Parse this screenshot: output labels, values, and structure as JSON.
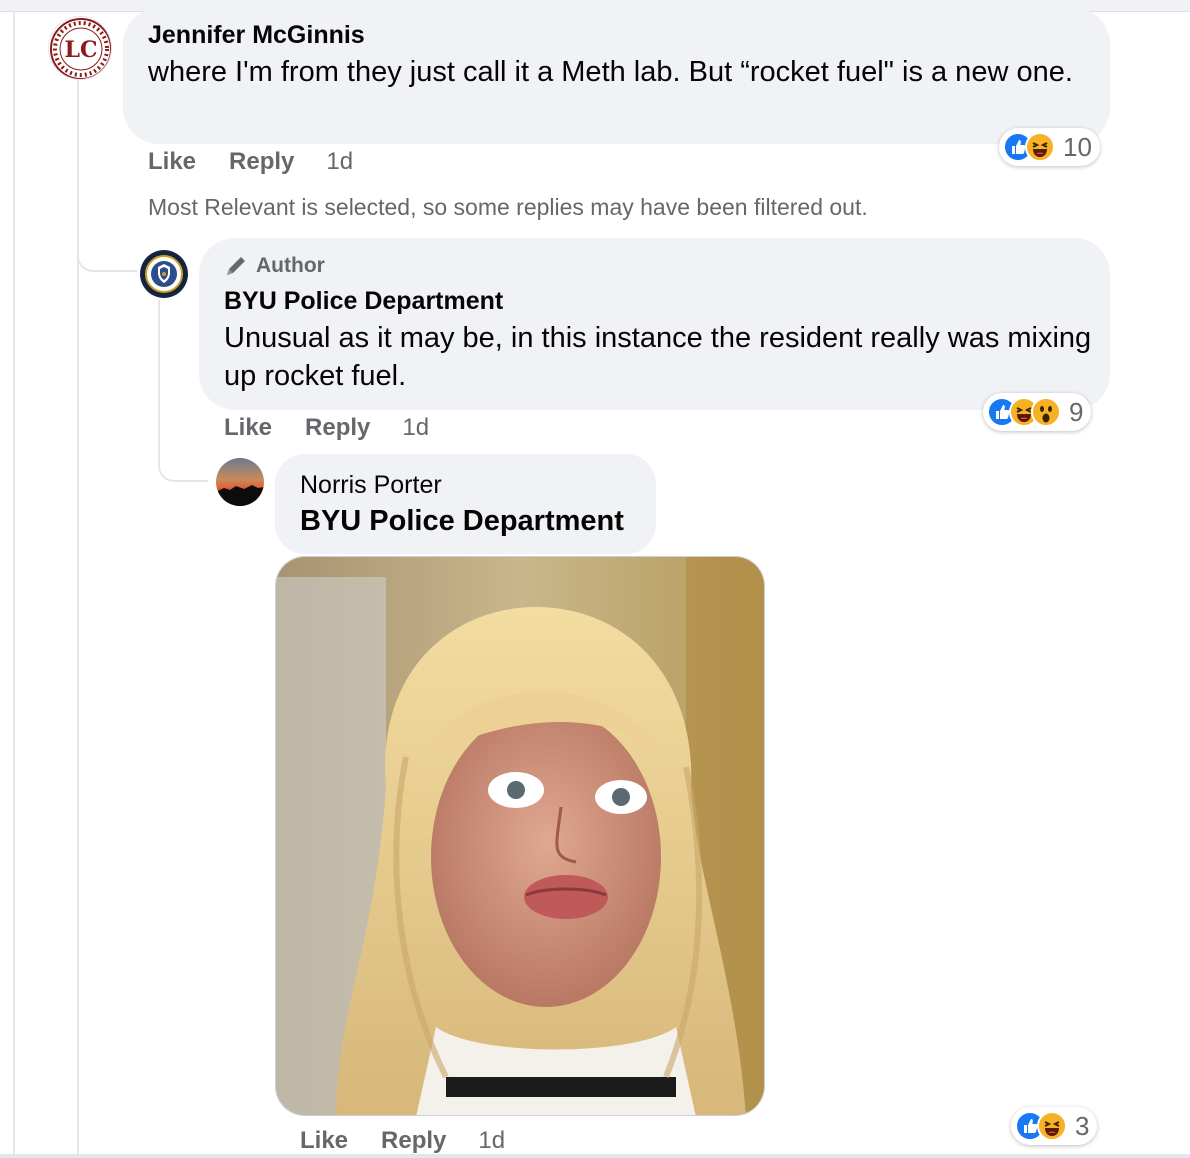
{
  "comments": [
    {
      "author": "Jennifer McGinnis",
      "text": "where I'm from they just call it a Meth lab. But “rocket fuel\" is a new one.",
      "actions": {
        "like": "Like",
        "reply": "Reply",
        "time": "1d"
      },
      "reactions": {
        "types": [
          "like",
          "haha"
        ],
        "count": "10"
      }
    }
  ],
  "filter_notice": "Most Relevant is selected, so some replies may have been filtered out.",
  "replies": [
    {
      "badge": "Author",
      "author": "BYU Police Department",
      "text": "Unusual as it may be, in this instance the resident really was mixing up rocket fuel.",
      "actions": {
        "like": "Like",
        "reply": "Reply",
        "time": "1d"
      },
      "reactions": {
        "types": [
          "like",
          "haha",
          "wow"
        ],
        "count": "9"
      }
    },
    {
      "author": "Norris Porter",
      "mention": "BYU Police Department",
      "attachment": "gif",
      "actions": {
        "like": "Like",
        "reply": "Reply",
        "time": "1d"
      },
      "reactions": {
        "types": [
          "like",
          "haha"
        ],
        "count": "3"
      }
    }
  ],
  "colors": {
    "bubble": "#f0f2f5",
    "meta_text": "#65676b",
    "like_blue": "#1877f2",
    "haha_yellow": "#f7b125"
  },
  "icons": [
    "avatar-lc-logo",
    "avatar-police-seal",
    "avatar-sunset",
    "pencil-icon",
    "like-reaction-icon",
    "haha-reaction-icon",
    "wow-reaction-icon"
  ]
}
